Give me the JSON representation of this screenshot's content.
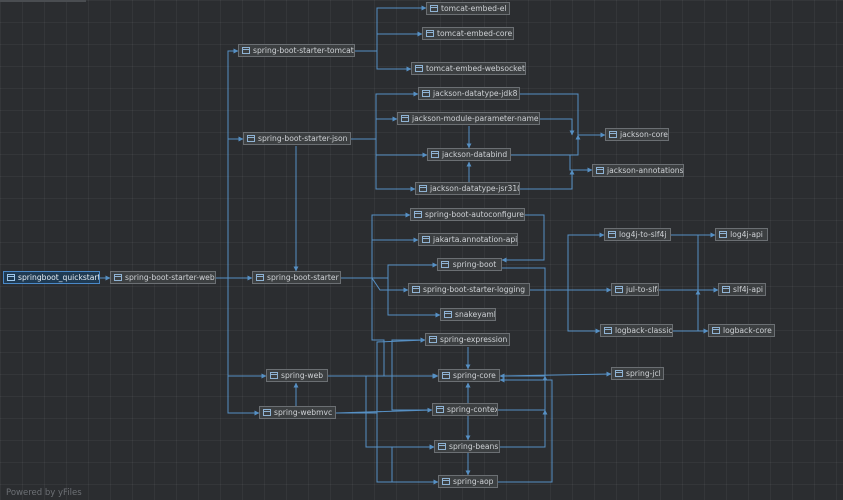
{
  "footer": "Powered by yFiles",
  "colors": {
    "edge": "#5b9bd5",
    "node_bg": "#3c3f41",
    "node_border": "#6b6f73",
    "text": "#cfd2d6",
    "root_bg": "#1f3a52"
  },
  "icon": "package-icon",
  "nodes": {
    "root": "springboot_quickstart",
    "web": "spring-boot-starter-web",
    "tomcat": "spring-boot-starter-tomcat",
    "json": "spring-boot-starter-json",
    "starter": "spring-boot-starter",
    "spweb": "spring-web",
    "webmvc": "spring-webmvc",
    "el": "tomcat-embed-el",
    "core_t": "tomcat-embed-core",
    "ws": "tomcat-embed-websocket",
    "jdk8": "jackson-datatype-jdk8",
    "params": "jackson-module-parameter-names",
    "databind": "jackson-databind",
    "jsr310": "jackson-datatype-jsr310",
    "jcore": "jackson-core",
    "jann": "jackson-annotations",
    "autoconf": "spring-boot-autoconfigure",
    "jakarta": "jakarta.annotation-api",
    "boot": "spring-boot",
    "logging": "spring-boot-starter-logging",
    "snake": "snakeyaml",
    "expr": "spring-expression",
    "score": "spring-core",
    "ctx": "spring-context",
    "beans": "spring-beans",
    "aop": "spring-aop",
    "l4j2s": "log4j-to-slf4j",
    "l4japi": "log4j-api",
    "jul": "jul-to-slf4j",
    "slf4j": "slf4j-api",
    "classic": "logback-classic",
    "lbcore": "logback-core",
    "jcl": "spring-jcl"
  }
}
